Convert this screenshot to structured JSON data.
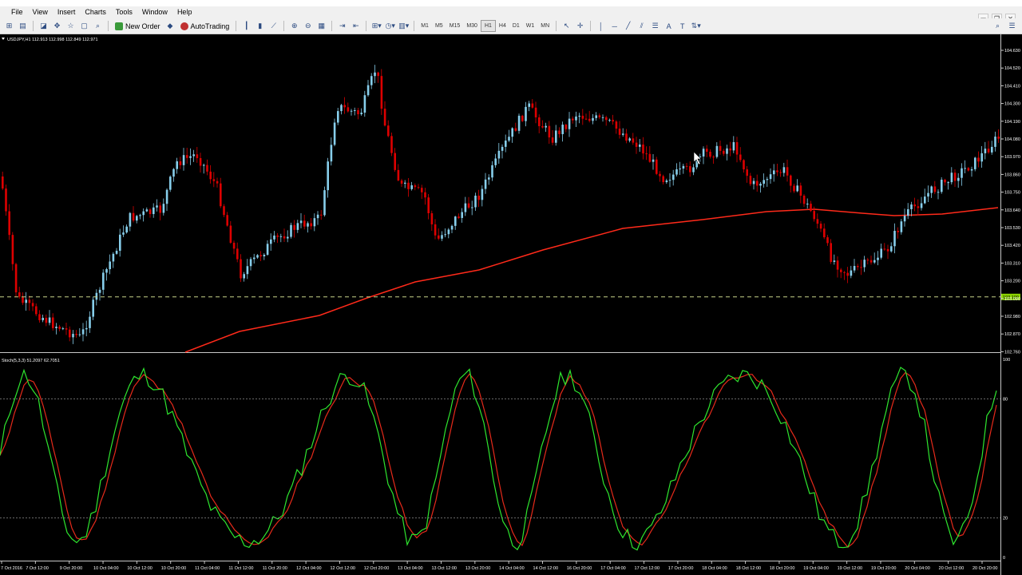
{
  "menu": [
    "File",
    "View",
    "Insert",
    "Charts",
    "Tools",
    "Window",
    "Help"
  ],
  "window_controls": {
    "minimize": "▭",
    "restore": "❐",
    "close": "✕"
  },
  "toolbar": {
    "new_order_label": "New Order",
    "autotrading_label": "AutoTrading",
    "timeframes": [
      "M1",
      "M5",
      "M15",
      "M30",
      "H1",
      "H4",
      "D1",
      "W1",
      "MN"
    ],
    "active_timeframe": "H1"
  },
  "main_chart": {
    "header": "USDJPY,H1  112.913 112.998 112.849 112.971",
    "price_axis": [
      "104.630",
      "104.520",
      "104.410",
      "104.300",
      "104.190",
      "104.080",
      "103.970",
      "103.860",
      "103.750",
      "103.640",
      "103.530",
      "103.420",
      "103.310",
      "103.200",
      "103.090",
      "102.980",
      "102.870",
      "102.760"
    ],
    "current_price": "103.100",
    "colors": {
      "bull": "#87ceeb",
      "bear": "#dd0000",
      "ma": "#ff2a1a",
      "level": "#c8d48a",
      "price_tag": "#8cd400"
    }
  },
  "indicator": {
    "header": "Stoch(5,3,3) 51.2097 62.7051",
    "levels": [
      "100",
      "80",
      "20",
      "0"
    ],
    "colors": {
      "main": "#2ee62e",
      "signal": "#e62a1a"
    }
  },
  "time_axis": [
    "7 Oct 2016",
    "7 Oct 12:00",
    "9 Oct 20:00",
    "10 Oct 04:00",
    "10 Oct 12:00",
    "10 Oct 20:00",
    "11 Oct 04:00",
    "11 Oct 12:00",
    "11 Oct 20:00",
    "12 Oct 04:00",
    "12 Oct 12:00",
    "12 Oct 20:00",
    "13 Oct 04:00",
    "13 Oct 12:00",
    "13 Oct 20:00",
    "14 Oct 04:00",
    "14 Oct 12:00",
    "16 Oct 20:00",
    "17 Oct 04:00",
    "17 Oct 12:00",
    "17 Oct 20:00",
    "18 Oct 04:00",
    "18 Oct 12:00",
    "18 Oct 20:00",
    "19 Oct 04:00",
    "19 Oct 12:00",
    "19 Oct 20:00",
    "20 Oct 04:00",
    "20 Oct 12:00",
    "20 Oct 20:00"
  ]
}
